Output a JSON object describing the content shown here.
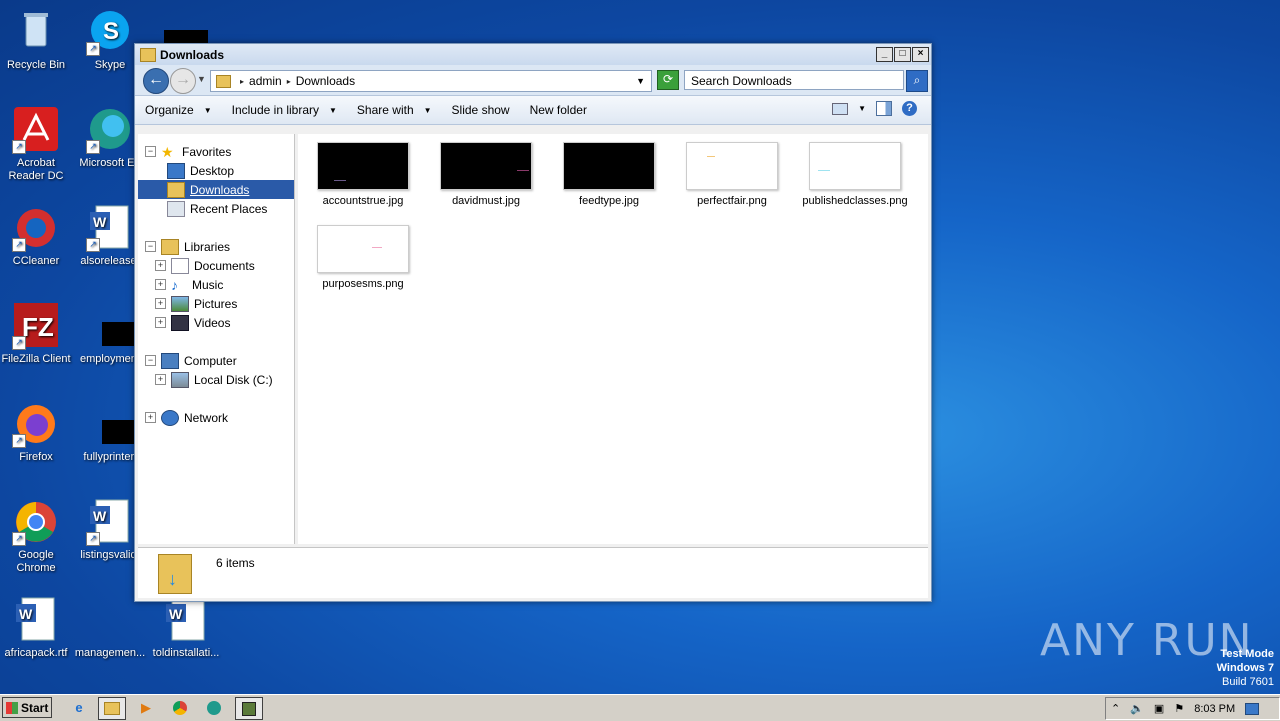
{
  "desktop": {
    "icons": [
      {
        "label": "Recycle Bin"
      },
      {
        "label": "Skype"
      },
      {
        "label": "Acrobat Reader DC"
      },
      {
        "label": "Microsoft Ed"
      },
      {
        "label": "CCleaner"
      },
      {
        "label": "alsorelease."
      },
      {
        "label": "FileZilla Client"
      },
      {
        "label": "employment"
      },
      {
        "label": "Firefox"
      },
      {
        "label": "fullyprinter."
      },
      {
        "label": "Google Chrome"
      },
      {
        "label": "listingsvalid."
      },
      {
        "label": "africapack.rtf"
      },
      {
        "label": "managemen..."
      },
      {
        "label": "toldinstallati..."
      }
    ]
  },
  "window": {
    "title": "Downloads",
    "controls": {
      "minimize": "_",
      "maximize": "□",
      "close": "×"
    },
    "breadcrumb": [
      "admin",
      "Downloads"
    ],
    "search_placeholder": "Search Downloads",
    "toolbar": {
      "organize": "Organize",
      "include_in_library": "Include in library",
      "share_with": "Share with",
      "slide_show": "Slide show",
      "new_folder": "New folder"
    },
    "nav": {
      "favorites": "Favorites",
      "desktop": "Desktop",
      "downloads": "Downloads",
      "recent_places": "Recent Places",
      "libraries": "Libraries",
      "documents": "Documents",
      "music": "Music",
      "pictures": "Pictures",
      "videos": "Videos",
      "computer": "Computer",
      "local_disk": "Local Disk (C:)",
      "network": "Network"
    },
    "files": [
      {
        "name": "accountstrue.jpg",
        "thumb": "dark"
      },
      {
        "name": "davidmust.jpg",
        "thumb": "dark"
      },
      {
        "name": "feedtype.jpg",
        "thumb": "dark"
      },
      {
        "name": "perfectfair.png",
        "thumb": "light"
      },
      {
        "name": "publishedclasses.png",
        "thumb": "light"
      },
      {
        "name": "purposesms.png",
        "thumb": "light"
      }
    ],
    "status": "6 items"
  },
  "taskbar": {
    "start": "Start",
    "clock": "8:03 PM"
  },
  "watermark": {
    "brand": "ANY RUN",
    "line1": "Test Mode",
    "line2": "Windows 7",
    "line3": "Build 7601"
  }
}
